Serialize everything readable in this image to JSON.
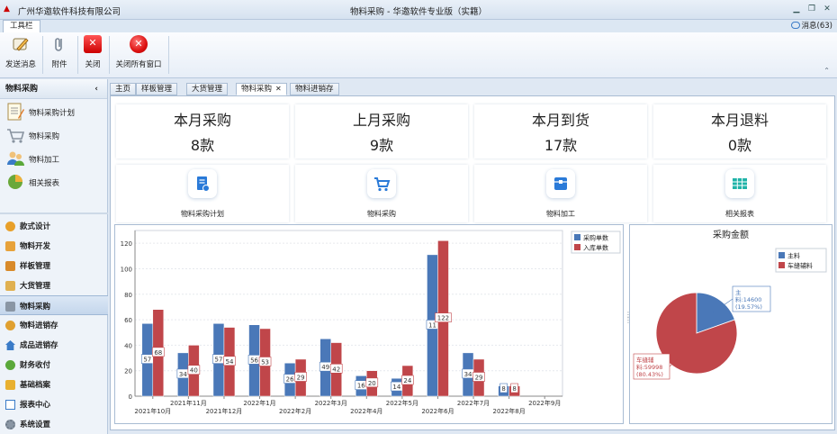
{
  "window": {
    "company": "广州华邀软件科技有限公司",
    "title": "物料采购 - 华邀软件专业版（实籍）"
  },
  "ribbon": {
    "tab_label": "工具栏",
    "message_label": "消息(63)",
    "buttons": [
      {
        "label": "发送消息",
        "icon": "pencil-message-icon"
      },
      {
        "label": "附件",
        "icon": "paperclip-icon"
      },
      {
        "label": "关闭",
        "icon": "close-icon"
      },
      {
        "label": "关闭所有窗口",
        "icon": "close-all-icon"
      }
    ]
  },
  "sidebar": {
    "section_title": "物料采购",
    "sub_items": [
      {
        "label": "物料采购计划",
        "icon": "notepad-icon"
      },
      {
        "label": "物料采购",
        "icon": "cart-icon"
      },
      {
        "label": "物料加工",
        "icon": "people-icon"
      },
      {
        "label": "相关报表",
        "icon": "pie-chart-icon"
      }
    ],
    "nav_items": [
      {
        "label": "款式设计",
        "icon": "design-icon"
      },
      {
        "label": "物料开发",
        "icon": "develop-icon"
      },
      {
        "label": "样板管理",
        "icon": "sample-icon"
      },
      {
        "label": "大货管理",
        "icon": "bulk-icon"
      },
      {
        "label": "物料采购",
        "icon": "purchase-icon",
        "active": true
      },
      {
        "label": "物料进销存",
        "icon": "inventory-icon"
      },
      {
        "label": "成品进销存",
        "icon": "home-icon"
      },
      {
        "label": "财务收付",
        "icon": "finance-icon"
      },
      {
        "label": "基础档案",
        "icon": "archive-icon"
      },
      {
        "label": "报表中心",
        "icon": "report-icon"
      },
      {
        "label": "系统设置",
        "icon": "gear-icon"
      }
    ]
  },
  "doc_tabs": [
    {
      "label": "主页"
    },
    {
      "label": "样板管理"
    },
    {
      "label": "大货管理"
    },
    {
      "label": "物料采购",
      "active": true,
      "close": "✕"
    },
    {
      "label": "物料进销存"
    }
  ],
  "stats": [
    {
      "title": "本月采购",
      "value": "8款"
    },
    {
      "title": "上月采购",
      "value": "9款"
    },
    {
      "title": "本月到货",
      "value": "17款"
    },
    {
      "title": "本月退料",
      "value": "0款"
    }
  ],
  "quick_actions": [
    {
      "label": "物料采购计划",
      "icon": "plan-icon"
    },
    {
      "label": "物料采购",
      "icon": "cart-icon"
    },
    {
      "label": "物料加工",
      "icon": "box-icon"
    },
    {
      "label": "相关报表",
      "icon": "table-icon"
    }
  ],
  "colors": {
    "blue": "#4a78b8",
    "red": "#c0464a"
  },
  "chart_data": [
    {
      "type": "bar",
      "categories": [
        "2021年10月",
        "2021年11月",
        "2021年12月",
        "2022年1月",
        "2022年2月",
        "2022年3月",
        "2022年4月",
        "2022年5月",
        "2022年6月",
        "2022年7月",
        "2022年8月",
        "2022年9月"
      ],
      "series": [
        {
          "name": "采购单数",
          "color": "#4a78b8",
          "values": [
            57,
            34,
            57,
            56,
            26,
            45,
            16,
            14,
            111,
            34,
            8,
            0
          ]
        },
        {
          "name": "入库单数",
          "color": "#c0464a",
          "values": [
            68,
            40,
            54,
            53,
            29,
            42,
            20,
            24,
            122,
            29,
            8,
            0
          ]
        }
      ],
      "data_labels": {
        "采购单数": [
          "57",
          "34",
          "57",
          "56",
          "26",
          "49",
          "16",
          "14",
          "11",
          "34",
          "8",
          ""
        ],
        "入库单数": [
          "68",
          "40",
          "54",
          "53",
          "29",
          "42",
          "20",
          "24",
          "122",
          "29",
          "8",
          ""
        ]
      },
      "yticks": [
        0,
        20,
        40,
        60,
        80,
        100,
        120
      ],
      "ylim": [
        0,
        130
      ],
      "legend": "top-right"
    },
    {
      "type": "pie",
      "title": "采购金额",
      "labels": [
        "主料",
        "车缝辅料"
      ],
      "values": [
        14600,
        59998
      ],
      "percents": [
        "19.57%",
        "80.43%"
      ],
      "colors": [
        "#4a78b8",
        "#c0464a"
      ],
      "annotations": [
        {
          "lines": [
            "主",
            "料:14600",
            "(19.57%)"
          ]
        },
        {
          "lines": [
            "车缝辅",
            "料:59998",
            "(80.43%)"
          ]
        }
      ],
      "legend": "top-right"
    }
  ]
}
